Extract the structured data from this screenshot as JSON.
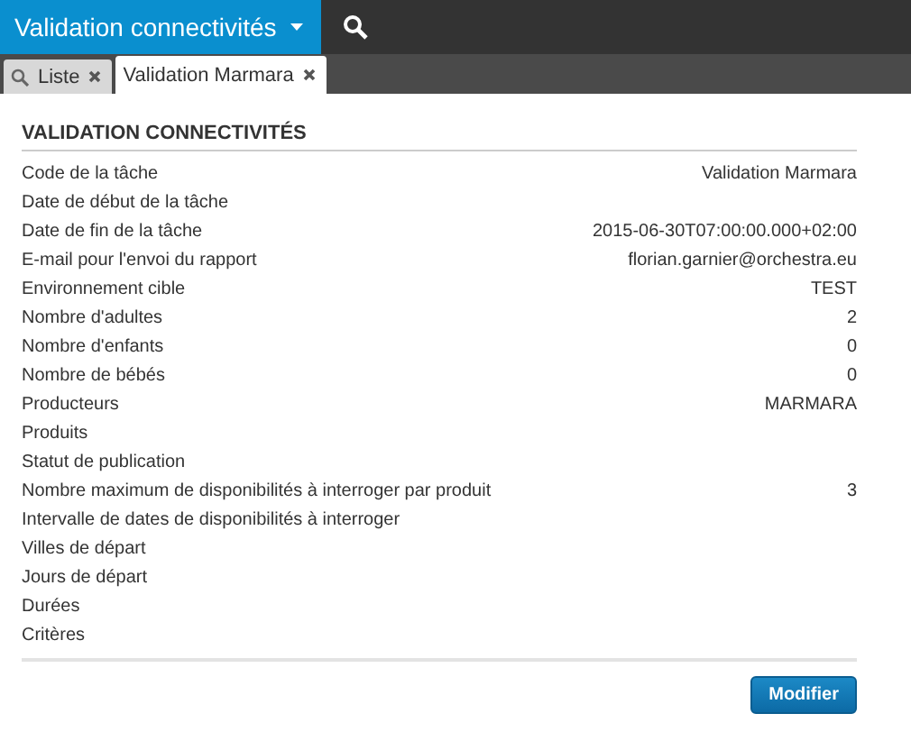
{
  "app_bar": {
    "title": "Validation connectivités"
  },
  "tabs": [
    {
      "label": "Liste",
      "selected": false
    },
    {
      "label": "Validation Marmara",
      "selected": true
    }
  ],
  "section": {
    "title": "VALIDATION CONNECTIVITÉS"
  },
  "fields": [
    {
      "label": "Code de la tâche",
      "value": "Validation Marmara"
    },
    {
      "label": "Date de début de la tâche"
    },
    {
      "label": "Date de fin de la tâche",
      "value": "2015-06-30T07:00:00.000+02:00"
    },
    {
      "label": "E-mail pour l'envoi du rapport",
      "value": "florian.garnier@orchestra.eu"
    },
    {
      "label": "Environnement cible",
      "value": "TEST"
    },
    {
      "label": "Nombre d'adultes",
      "value": "2"
    },
    {
      "label": "Nombre d'enfants",
      "value": "0"
    },
    {
      "label": "Nombre de bébés",
      "value": "0"
    },
    {
      "label": "Producteurs",
      "value": "MARMARA"
    },
    {
      "label": "Produits"
    },
    {
      "label": "Statut de publication"
    },
    {
      "label": "Nombre maximum de disponibilités à interroger par produit",
      "value": "3"
    },
    {
      "label": "Intervalle de dates de disponibilités à interroger"
    },
    {
      "label": "Villes de départ"
    },
    {
      "label": "Jours de départ"
    },
    {
      "label": "Durées"
    },
    {
      "label": "Critères"
    }
  ],
  "buttons": [
    "Modifier"
  ]
}
